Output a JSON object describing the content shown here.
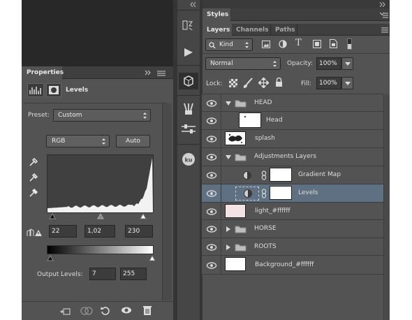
{
  "properties": {
    "tab_label": "Properties",
    "header_label": "Levels",
    "preset_label": "Preset:",
    "preset_value": "Custom",
    "channel_value": "RGB",
    "auto_label": "Auto",
    "input_levels": [
      "22",
      "1,02",
      "230"
    ],
    "output_label": "Output Levels:",
    "output_levels": [
      "7",
      "255"
    ]
  },
  "styles_tab": "Styles",
  "layers_panel": {
    "tabs": [
      "Layers",
      "Channels",
      "Paths"
    ],
    "kind_label": "Kind",
    "blend_mode": "Normal",
    "opacity_label": "Opacity:",
    "opacity_value": "100%",
    "lock_label": "Lock:",
    "fill_label": "Fill:",
    "fill_value": "100%",
    "layers": [
      {
        "name": "HEAD",
        "type": "group-open"
      },
      {
        "name": "Head",
        "type": "layer"
      },
      {
        "name": "splash",
        "type": "layer"
      },
      {
        "name": "Adjustments Layers",
        "type": "group-open"
      },
      {
        "name": "Gradient Map",
        "type": "adjustment"
      },
      {
        "name": "Levels",
        "type": "adjustment",
        "selected": true
      },
      {
        "name": "light_#ffffff",
        "type": "layer"
      },
      {
        "name": "HORSE",
        "type": "group-closed"
      },
      {
        "name": "ROOTS",
        "type": "group-closed"
      },
      {
        "name": "Background_#ffffff",
        "type": "layer"
      }
    ]
  },
  "icons": [
    "eye-icon",
    "folder-icon",
    "chain-link-icon",
    "adjustment-circle-icon",
    "eyedropper-icon",
    "lock-icon",
    "trash-icon",
    "brush-icon",
    "move-icon"
  ],
  "histogram": {
    "peak_right": true
  }
}
